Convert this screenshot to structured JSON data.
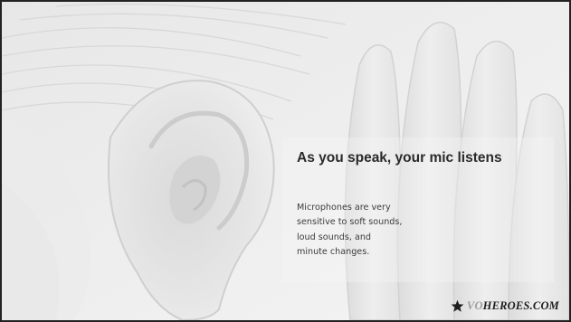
{
  "slide": {
    "title": "As you speak, your mic listens",
    "body_lines": [
      "Microphones are very",
      "sensitive to soft sounds,",
      "loud sounds, and",
      "minute changes."
    ]
  },
  "image": {
    "subject": "ear-and-cupped-hand-photo"
  },
  "logo": {
    "prefix": "VO",
    "suffix": "HEROES.COM",
    "icon": "star-icon"
  },
  "colors": {
    "background": "#f1f1f1",
    "border": "#222222",
    "title": "#2a2a2a",
    "body": "#3c3c3c",
    "logo_dark": "#1e1e1e",
    "logo_grey": "#9c9c9c"
  }
}
